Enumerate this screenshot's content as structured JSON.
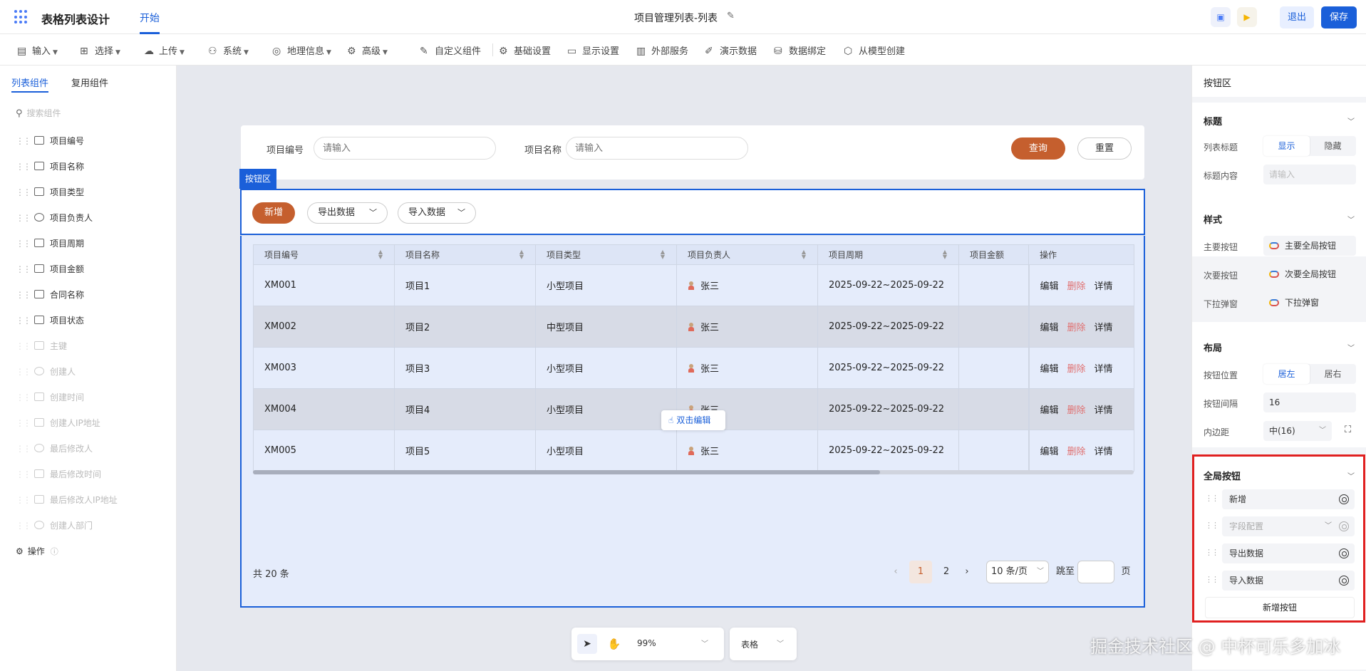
{
  "header": {
    "app_title": "表格列表设计",
    "tab_start": "开始",
    "doc_title": "项目管理列表-列表",
    "exit": "退出",
    "save": "保存",
    "icons": [
      "scan-icon",
      "play-icon",
      "edit-icon",
      "grid-logo-icon"
    ]
  },
  "toolbar": {
    "items": [
      {
        "label": "输入",
        "icon": "input-icon",
        "caret": true
      },
      {
        "label": "选择",
        "icon": "select-icon",
        "caret": true
      },
      {
        "label": "上传",
        "icon": "upload-icon",
        "caret": true
      },
      {
        "label": "系统",
        "icon": "system-icon",
        "caret": true
      },
      {
        "label": "地理信息",
        "icon": "map-icon",
        "caret": true
      },
      {
        "label": "高级",
        "icon": "advanced-icon",
        "caret": true
      },
      {
        "label": "自定义组件",
        "icon": "custom-icon",
        "caret": false
      },
      {
        "label": "基础设置",
        "icon": "settings-icon",
        "caret": false
      },
      {
        "label": "显示设置",
        "icon": "display-icon",
        "caret": false
      },
      {
        "label": "外部服务",
        "icon": "service-icon",
        "caret": false
      },
      {
        "label": "演示数据",
        "icon": "demo-icon",
        "caret": false
      },
      {
        "label": "数据绑定",
        "icon": "database-icon",
        "caret": false
      },
      {
        "label": "从模型创建",
        "icon": "model-icon",
        "caret": false
      }
    ]
  },
  "left": {
    "tabs": [
      "列表组件",
      "复用组件"
    ],
    "search_placeholder": "搜索组件",
    "items": [
      {
        "label": "项目编号",
        "disabled": false
      },
      {
        "label": "项目名称",
        "disabled": false
      },
      {
        "label": "项目类型",
        "disabled": false
      },
      {
        "label": "项目负责人",
        "disabled": false
      },
      {
        "label": "项目周期",
        "disabled": false
      },
      {
        "label": "项目金额",
        "disabled": false
      },
      {
        "label": "合同名称",
        "disabled": false
      },
      {
        "label": "项目状态",
        "disabled": false
      },
      {
        "label": "主键",
        "disabled": true
      },
      {
        "label": "创建人",
        "disabled": true
      },
      {
        "label": "创建时间",
        "disabled": true
      },
      {
        "label": "创建人IP地址",
        "disabled": true
      },
      {
        "label": "最后修改人",
        "disabled": true
      },
      {
        "label": "最后修改时间",
        "disabled": true
      },
      {
        "label": "最后修改人IP地址",
        "disabled": true
      },
      {
        "label": "创建人部门",
        "disabled": true
      }
    ],
    "ops_label": "操作"
  },
  "search": {
    "label1": "项目编号",
    "placeholder1": "请输入",
    "label2": "项目名称",
    "placeholder2": "请输入",
    "query": "查询",
    "reset": "重置"
  },
  "btnarea": {
    "tag": "按钮区",
    "add": "新增",
    "export": "导出数据",
    "import": "导入数据"
  },
  "table": {
    "headers": [
      "项目编号",
      "项目名称",
      "项目类型",
      "项目负责人",
      "项目周期",
      "项目金额",
      "操作"
    ],
    "rows": [
      [
        "XM001",
        "项目1",
        "小型项目",
        "张三",
        "2025-09-22~2025-09-22",
        ""
      ],
      [
        "XM002",
        "项目2",
        "中型项目",
        "张三",
        "2025-09-22~2025-09-22",
        ""
      ],
      [
        "XM003",
        "项目3",
        "小型项目",
        "张三",
        "2025-09-22~2025-09-22",
        ""
      ],
      [
        "XM004",
        "项目4",
        "小型项目",
        "张三",
        "2025-09-22~2025-09-22",
        ""
      ],
      [
        "XM005",
        "项目5",
        "小型项目",
        "张三",
        "2025-09-22~2025-09-22",
        ""
      ]
    ],
    "ops": [
      "编辑",
      "删除",
      "详情"
    ],
    "dbl_edit": "双击编辑"
  },
  "pagination": {
    "total": "共 20 条",
    "pages": [
      "1",
      "2"
    ],
    "current": "1",
    "size": "10 条/页",
    "jump": "跳至",
    "page_unit": "页"
  },
  "bottom": {
    "zoom": "99%",
    "view": "表格"
  },
  "right": {
    "header": "按钮区",
    "title_sec": {
      "title": "标题",
      "list_title_label": "列表标题",
      "show": "显示",
      "hide": "隐藏",
      "content_label": "标题内容",
      "content_placeholder": "请输入"
    },
    "style_sec": {
      "title": "样式",
      "primary_label": "主要按钮",
      "primary_value": "主要全局按钮",
      "secondary_label": "次要按钮",
      "secondary_value": "次要全局按钮",
      "dropdown_label": "下拉弹窗",
      "dropdown_value": "下拉弹窗"
    },
    "layout_sec": {
      "title": "布局",
      "position_label": "按钮位置",
      "left": "居左",
      "right": "居右",
      "gap_label": "按钮间隔",
      "gap_value": "16",
      "padding_label": "内边距",
      "padding_value": "中(16)"
    },
    "global_sec": {
      "title": "全局按钮",
      "items": [
        {
          "label": "新增",
          "dim": false
        },
        {
          "label": "字段配置",
          "dim": true
        },
        {
          "label": "导出数据",
          "dim": false
        },
        {
          "label": "导入数据",
          "dim": false
        }
      ],
      "add": "新增按钮"
    }
  },
  "watermark": "掘金技术社区 @ 中杯可乐多加冰",
  "colors": {
    "primary": "#1a5fd9",
    "accent": "#c55f2e",
    "danger": "#e07070",
    "highlight": "#e02020"
  }
}
